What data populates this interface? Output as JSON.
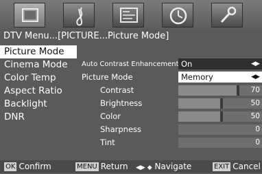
{
  "tabs": [
    {
      "icon": "tv-icon",
      "active": true
    },
    {
      "icon": "music-note-icon",
      "active": false
    },
    {
      "icon": "picture-icon",
      "active": false
    },
    {
      "icon": "clock-icon",
      "active": false
    },
    {
      "icon": "wrench-icon",
      "active": false
    }
  ],
  "breadcrumb": "DTV Menu...[PICTURE...Picture Mode]",
  "left_menu": [
    {
      "label": "Picture Mode",
      "selected": true
    },
    {
      "label": "Cinema Mode",
      "selected": false
    },
    {
      "label": "Color Temp",
      "selected": false
    },
    {
      "label": "Aspect Ratio",
      "selected": false
    },
    {
      "label": "Backlight",
      "selected": false
    },
    {
      "label": "DNR",
      "selected": false
    }
  ],
  "settings": {
    "auto_contrast": {
      "label": "Auto Contrast Enhancement",
      "value": "On"
    },
    "picture_mode": {
      "label": "Picture Mode",
      "value": "Memory"
    },
    "arrows": "◀▶",
    "sliders": [
      {
        "label": "Contrast",
        "value": "70",
        "level": 0.7
      },
      {
        "label": "Brightness",
        "value": "50",
        "level": 0.5
      },
      {
        "label": "Color",
        "value": "50",
        "level": 0.5
      },
      {
        "label": "Sharpness",
        "value": "0",
        "level": 0.0
      },
      {
        "label": "Tint",
        "value": "0",
        "level": 0.0
      }
    ]
  },
  "help_bar": {
    "ok_key": "OK",
    "ok_label": "Confirm",
    "menu_key": "MENU",
    "menu_label": "Return",
    "nav_symbol": "◀▶ ◆",
    "nav_label": "Navigate",
    "exit_key": "EXIT",
    "exit_label": "Cancel"
  }
}
